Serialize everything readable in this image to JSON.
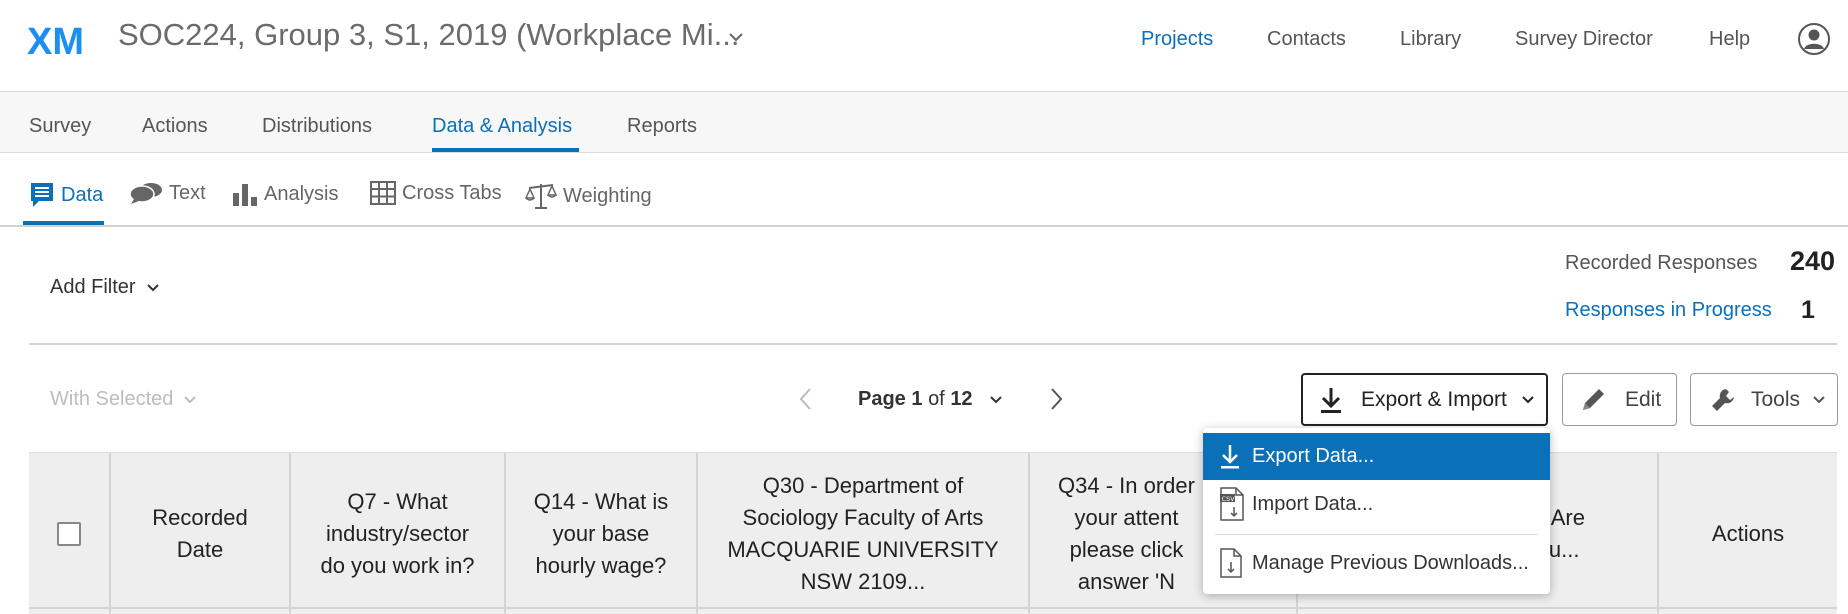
{
  "header": {
    "logo_text": "XM",
    "project_title": "SOC224, Group 3, S1, 2019 (Workplace Mi...",
    "nav": [
      "Projects",
      "Contacts",
      "Library",
      "Survey Director",
      "Help"
    ],
    "active_nav": "Projects"
  },
  "secondary_tabs": [
    "Survey",
    "Actions",
    "Distributions",
    "Data & Analysis",
    "Reports"
  ],
  "active_secondary_tab": "Data & Analysis",
  "tertiary_tabs": [
    "Data",
    "Text",
    "Analysis",
    "Cross Tabs",
    "Weighting"
  ],
  "active_tertiary_tab": "Data",
  "filter": {
    "add_filter_label": "Add Filter"
  },
  "stats": {
    "recorded_label": "Recorded Responses",
    "recorded_value": "240",
    "in_progress_label": "Responses in Progress",
    "in_progress_value": "1"
  },
  "toolbar": {
    "with_selected": "With Selected",
    "page_word": "Page",
    "page_current": "1",
    "page_of": "of",
    "page_total": "12",
    "export_import": "Export & Import",
    "edit": "Edit",
    "tools": "Tools"
  },
  "dropdown": {
    "items": [
      "Export Data...",
      "Import Data...",
      "Manage Previous Downloads..."
    ],
    "highlighted": "Export Data..."
  },
  "table": {
    "columns": [
      "Recorded Date",
      "Q7 - What industry/sector do you work in?",
      "Q14 - What is your base hourly wage?",
      "Q30 - Department of Sociology Faculty of Arts MACQUARIE UNIVERSITY NSW 2109...",
      "Q34 - In order to check your attention please click answer 'N...",
      "...2 - Are you...",
      "Actions"
    ],
    "column_segments": {
      "c1": "Recorded",
      "c1b": "Date",
      "c2": [
        "Q7 - What",
        "industry/sector",
        "do you work in?"
      ],
      "c3": [
        "Q14 - What is",
        "your base",
        "hourly wage?"
      ],
      "c4": [
        "Q30 - Department of",
        "Sociology Faculty of Arts",
        "MACQUARIE UNIVERSITY",
        "NSW 2109..."
      ],
      "c5": [
        "Q34 - In order",
        "your attent",
        "please click",
        "answer 'N"
      ],
      "c6": [
        "2 - Are",
        "you..."
      ],
      "c7": "Actions"
    }
  },
  "colors": {
    "accent": "#0a70b8",
    "logo": "#1c8ff0"
  }
}
